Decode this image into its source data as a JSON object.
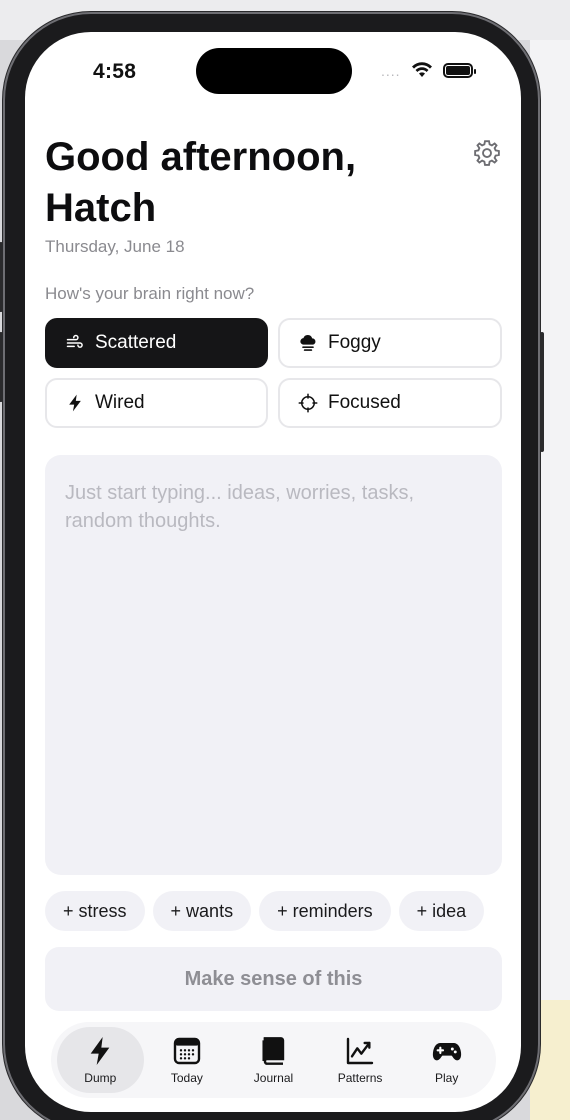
{
  "status": {
    "time": "4:58",
    "signal": "....",
    "wifi_icon": "wifi-icon",
    "battery_icon": "battery-icon"
  },
  "header": {
    "greeting": "Good afternoon,",
    "name": "Hatch",
    "date": "Thursday, June 18",
    "settings_icon": "gear-icon"
  },
  "mood": {
    "question": "How's your brain right now?",
    "options": [
      {
        "label": "Scattered",
        "icon": "wind-icon",
        "selected": true
      },
      {
        "label": "Foggy",
        "icon": "cloud-icon",
        "selected": false
      },
      {
        "label": "Wired",
        "icon": "bolt-icon",
        "selected": false
      },
      {
        "label": "Focused",
        "icon": "crosshair-icon",
        "selected": false
      }
    ]
  },
  "dump": {
    "placeholder": "Just start typing... ideas, worries, tasks, random thoughts."
  },
  "chips": [
    "+ stress",
    "+ wants",
    "+ reminders",
    "+ idea"
  ],
  "cta": {
    "label": "Make sense of this"
  },
  "tabs": [
    {
      "label": "Dump",
      "icon": "bolt-icon",
      "active": true
    },
    {
      "label": "Today",
      "icon": "calendar-icon",
      "active": false
    },
    {
      "label": "Journal",
      "icon": "book-icon",
      "active": false
    },
    {
      "label": "Patterns",
      "icon": "chart-icon",
      "active": false
    },
    {
      "label": "Play",
      "icon": "gamepad-icon",
      "active": false
    }
  ],
  "colors": {
    "accent": "#151517",
    "surface": "#f1f1f6",
    "muted": "#8a8a8f"
  }
}
